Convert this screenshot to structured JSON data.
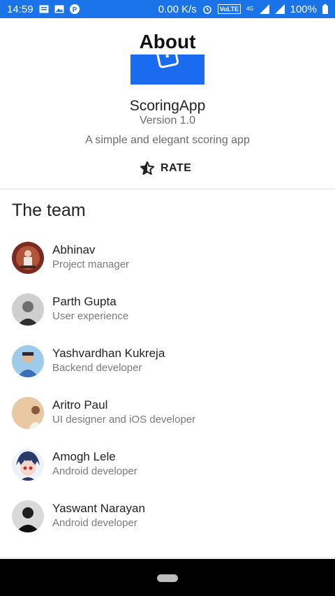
{
  "status_bar": {
    "time": "14:59",
    "net_speed": "0.00 K/s",
    "volte": "VoLTE",
    "network": "4G",
    "battery": "100%"
  },
  "header": {
    "title": "About",
    "app_name": "ScoringApp",
    "version": "Version 1.0",
    "description": "A simple and elegant scoring app",
    "rate_label": "RATE"
  },
  "team": {
    "title": "The team",
    "members": [
      {
        "name": "Abhinav",
        "role": "Project manager"
      },
      {
        "name": "Parth Gupta",
        "role": "User experience"
      },
      {
        "name": "Yashvardhan Kukreja",
        "role": "Backend developer"
      },
      {
        "name": "Aritro Paul",
        "role": "UI designer and iOS developer"
      },
      {
        "name": "Amogh Lele",
        "role": "Android developer"
      },
      {
        "name": "Yaswant Narayan",
        "role": "Android developer"
      }
    ]
  },
  "colors": {
    "status_bar": "#1a73e8",
    "logo": "#1a6bf0",
    "nav_bar": "#000000"
  }
}
